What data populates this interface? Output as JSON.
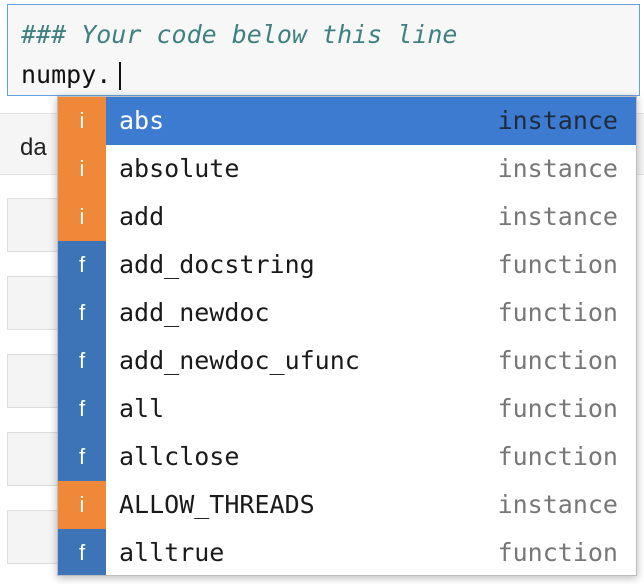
{
  "editor": {
    "comment_line": "### Your code below this line",
    "code_line": "numpy."
  },
  "background": {
    "partial_text": "da"
  },
  "colors": {
    "instance_badge": "#f0883a",
    "function_badge": "#3d74b8",
    "active_row": "#3d7bd1"
  },
  "completer": {
    "items": [
      {
        "badge": "i",
        "label": "abs",
        "type": "instance",
        "kind": "instance",
        "active": true
      },
      {
        "badge": "i",
        "label": "absolute",
        "type": "instance",
        "kind": "instance",
        "active": false
      },
      {
        "badge": "i",
        "label": "add",
        "type": "instance",
        "kind": "instance",
        "active": false
      },
      {
        "badge": "f",
        "label": "add_docstring",
        "type": "function",
        "kind": "function",
        "active": false
      },
      {
        "badge": "f",
        "label": "add_newdoc",
        "type": "function",
        "kind": "function",
        "active": false
      },
      {
        "badge": "f",
        "label": "add_newdoc_ufunc",
        "type": "function",
        "kind": "function",
        "active": false
      },
      {
        "badge": "f",
        "label": "all",
        "type": "function",
        "kind": "function",
        "active": false
      },
      {
        "badge": "f",
        "label": "allclose",
        "type": "function",
        "kind": "function",
        "active": false
      },
      {
        "badge": "i",
        "label": "ALLOW_THREADS",
        "type": "instance",
        "kind": "instance",
        "active": false
      },
      {
        "badge": "f",
        "label": "alltrue",
        "type": "function",
        "kind": "function",
        "active": false
      }
    ]
  }
}
